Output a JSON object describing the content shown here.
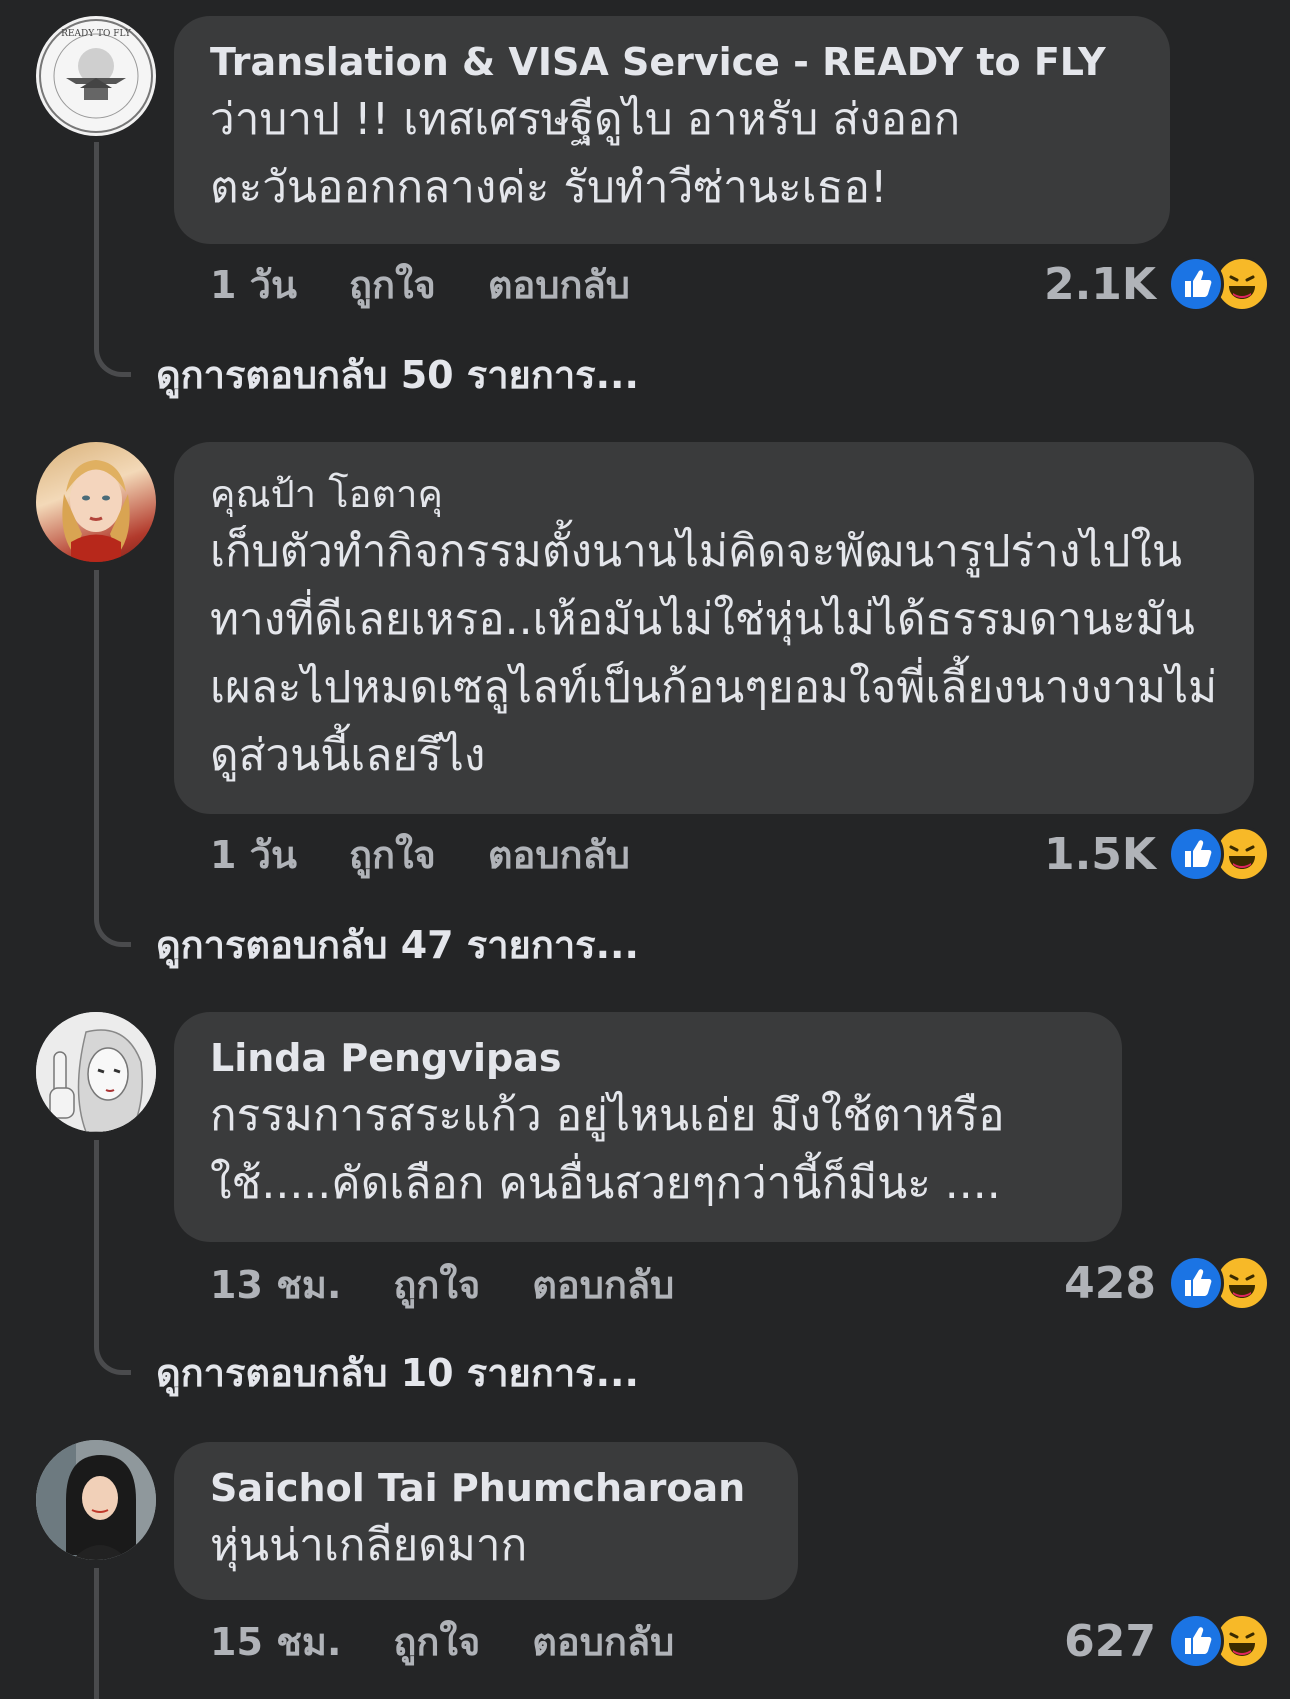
{
  "colors": {
    "background": "#242526",
    "bubble": "#3a3b3c",
    "like": "#1b74e4",
    "haha": "#f7b928"
  },
  "comments": [
    {
      "author": "Translation & VISA Service - READY to FLY",
      "avatar_logo_text": "READY TO FLY",
      "text": "ว่าบาป !! เทสเศรษฐีดูไบ  อาหรับ  ส่งออก ตะวันออกกลางค่ะ  รับทำวีซ่านะเธอ!",
      "time": "1 วัน",
      "like_label": "ถูกใจ",
      "reply_label": "ตอบกลับ",
      "reaction_count": "2.1K",
      "view_replies": "ดูการตอบกลับ 50 รายการ..."
    },
    {
      "author": "คุณป้า โอตาคุ",
      "text": "เก็บตัวทำกิจกรรมตั้งนานไม่คิดจะพัฒนารูปร่างไปในทางที่ดีเลยเหรอ..เห้อมันไม่ใช่หุ่นไม่ได้ธรรมดานะมันเผละไปหมดเซลูไลท์เป็นก้อนๆยอมใจพี่เลี้ยงนางงามไม่ดูส่วนนี้เลยรึไง",
      "time": "1 วัน",
      "like_label": "ถูกใจ",
      "reply_label": "ตอบกลับ",
      "reaction_count": "1.5K",
      "view_replies": "ดูการตอบกลับ 47 รายการ..."
    },
    {
      "author": "Linda Pengvipas",
      "text": "กรรมการสระแก้ว อยู่ไหนเอ่ย มึงใช้ตาหรือใช้.....คัดเลือก คนอื่นสวยๆกว่านี้ก็มีนะ ....",
      "time": "13 ชม.",
      "like_label": "ถูกใจ",
      "reply_label": "ตอบกลับ",
      "reaction_count": "428",
      "view_replies": "ดูการตอบกลับ 10 รายการ..."
    },
    {
      "author": "Saichol Tai Phumcharoan",
      "text": "หุ่นน่าเกลียดมาก",
      "time": "15 ชม.",
      "like_label": "ถูกใจ",
      "reply_label": "ตอบกลับ",
      "reaction_count": "627"
    }
  ]
}
